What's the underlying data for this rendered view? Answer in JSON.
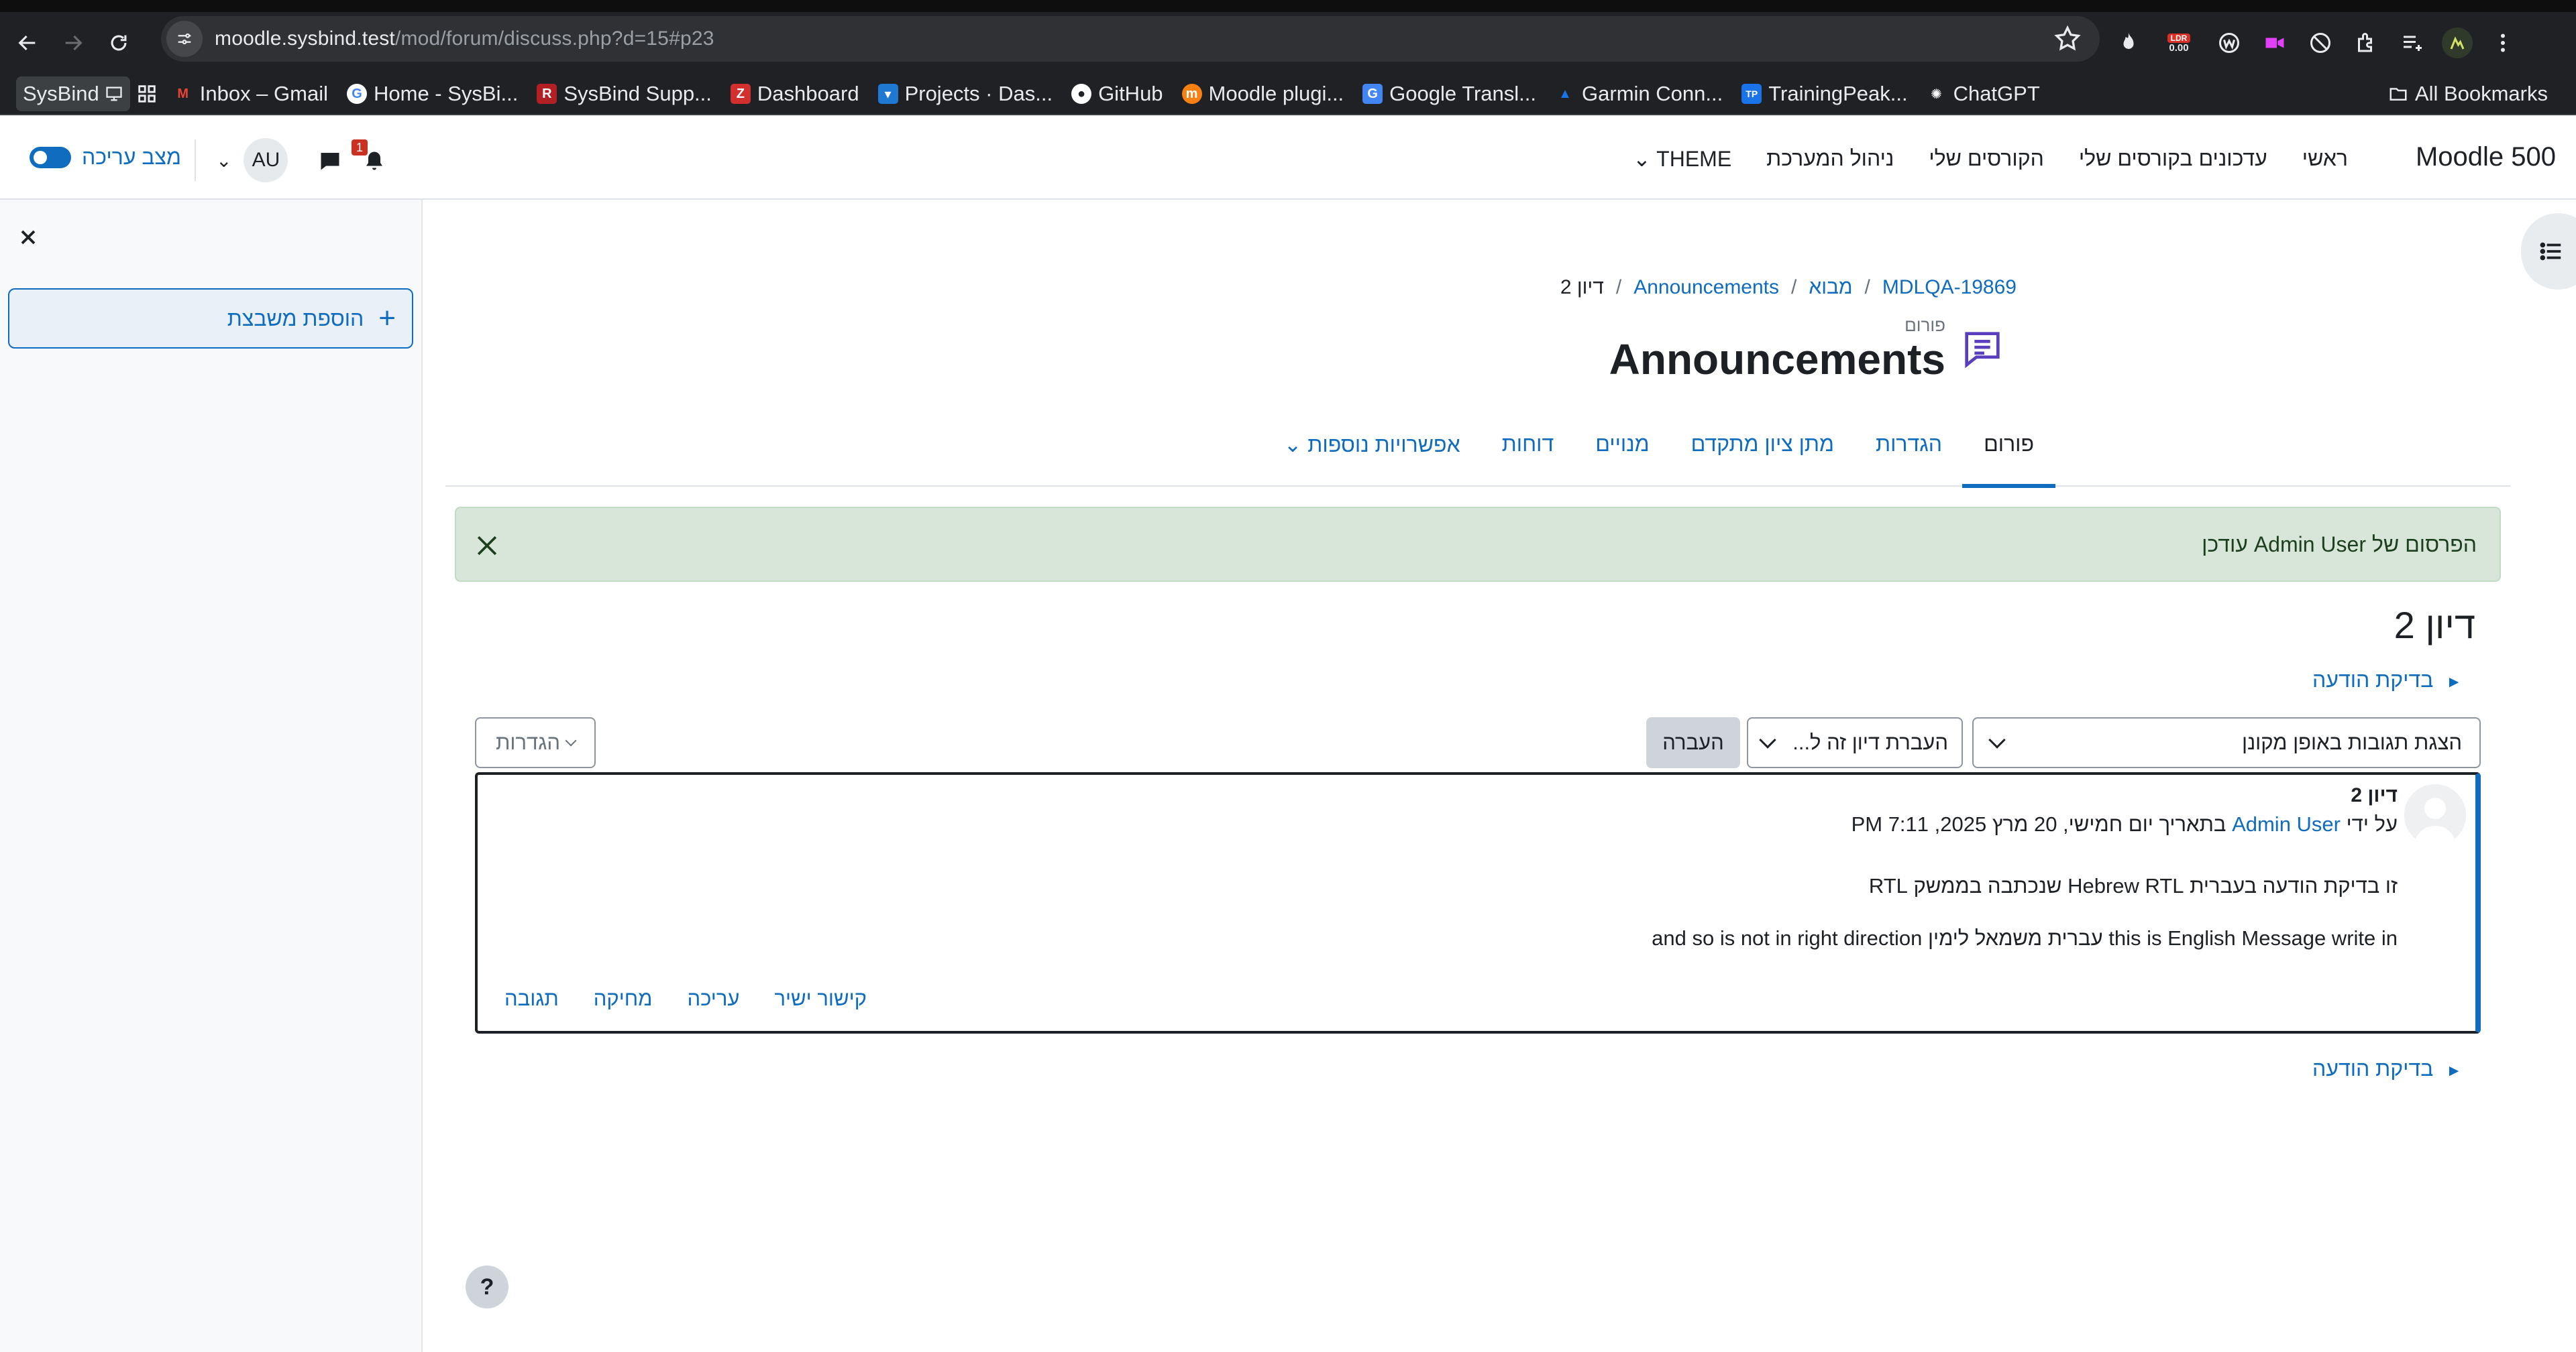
{
  "browser": {
    "url_host": "moodle.sysbind.test",
    "url_path": "/mod/forum/discuss.php?d=15#p23",
    "extensions": {
      "ldr_label": "LDR",
      "ldr_value": "0.00"
    },
    "bookmarks": [
      {
        "label": "SysBind",
        "icon": "computer-icon"
      },
      {
        "label": "Inbox – Gmail",
        "icon": "gmail-icon",
        "color": "#ea4335"
      },
      {
        "label": "Home - SysBi...",
        "icon": "google-icon",
        "color": "#4285f4"
      },
      {
        "label": "SysBind Supp...",
        "icon": "redmine-icon",
        "color": "#b32024"
      },
      {
        "label": "Dashboard",
        "icon": "zendesk-icon",
        "color": "#d32f2f"
      },
      {
        "label": "Projects · Das...",
        "icon": "gitlab-icon",
        "color": "#1f78d1"
      },
      {
        "label": "GitHub",
        "icon": "github-icon",
        "color": "#ffffff"
      },
      {
        "label": "Moodle plugi...",
        "icon": "moodle-icon",
        "color": "#f98012"
      },
      {
        "label": "Google Transl...",
        "icon": "translate-icon",
        "color": "#4285f4"
      },
      {
        "label": "Garmin Conn...",
        "icon": "garmin-icon",
        "color": "#1a73e8"
      },
      {
        "label": "TrainingPeak...",
        "icon": "trainingpeaks-icon",
        "color": "#1a73e8"
      },
      {
        "label": "ChatGPT",
        "icon": "chatgpt-icon",
        "color": "#ffffff"
      }
    ],
    "all_bookmarks": "All Bookmarks"
  },
  "navbar": {
    "brand": "Moodle 500",
    "primary": [
      "ראשי",
      "עדכונים בקורסים שלי",
      "הקורסים שלי",
      "ניהול המערכת",
      "THEME"
    ],
    "edit_mode_label": "מצב עריכה",
    "user_initials": "AU",
    "notification_count": "1"
  },
  "drawer": {
    "add_block_label": "הוספת משבצת"
  },
  "breadcrumb": [
    "MDLQA-19869",
    "מבוא",
    "Announcements",
    "דיון 2"
  ],
  "header": {
    "activity_label": "פורום",
    "title": "Announcements"
  },
  "tabs": [
    "פורום",
    "הגדרות",
    "מתן ציון מתקדם",
    "מנויים",
    "דוחות",
    "אפשרויות נוספות"
  ],
  "alert": {
    "message": "הפרסום של Admin User עודכן"
  },
  "discussion": {
    "title": "דיון 2",
    "check_message": "בדיקת הודעה",
    "display_mode": "הצגת תגובות באופן מקונן",
    "move_to": "העברת דיון זה ל...",
    "move_button": "העברה",
    "settings_button": "הגדרות"
  },
  "post": {
    "subject": "דיון 2",
    "by_prefix": "על ידי",
    "author": "Admin User",
    "date": "בתאריך יום חמישי, 20 מרץ 2025, 7:11 PM",
    "line1": "זו בדיקת הודעה בעברית Hebrew RTL שנכתבה בממשק RTL",
    "line2": "this is English Message write in עברית משמאל לימין and so is not in right direction",
    "actions": [
      "קישור ישיר",
      "עריכה",
      "מחיקה",
      "תגובה"
    ]
  },
  "help_label": "?",
  "colors": {
    "link": "#0f6cbf",
    "alert_bg": "#d7e6d8",
    "forum_icon": "#5b3ebd"
  }
}
